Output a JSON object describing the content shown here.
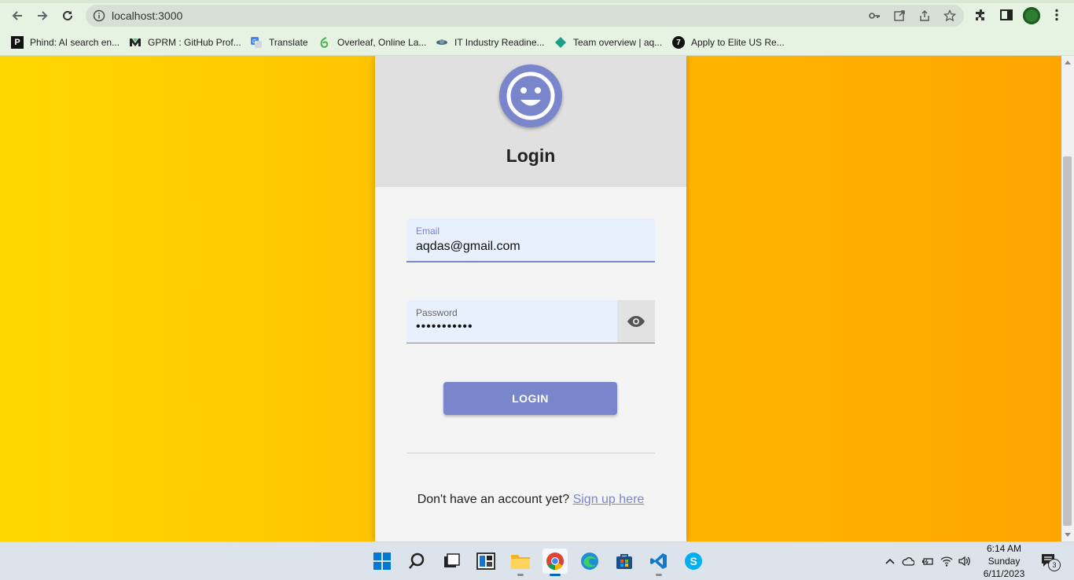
{
  "browser": {
    "url": "localhost:3000",
    "bookmarks": [
      {
        "label": "Phind: AI search en...",
        "icon": "phind-icon"
      },
      {
        "label": "GPRM : GitHub Prof...",
        "icon": "gprm-icon"
      },
      {
        "label": "Translate",
        "icon": "translate-icon"
      },
      {
        "label": "Overleaf, Online La...",
        "icon": "overleaf-icon"
      },
      {
        "label": "IT Industry Readine...",
        "icon": "it-industry-icon"
      },
      {
        "label": "Team overview | aq...",
        "icon": "team-overview-icon"
      },
      {
        "label": "Apply to Elite US Re...",
        "icon": "apply-icon"
      }
    ]
  },
  "login": {
    "title": "Login",
    "email_label": "Email",
    "email_value": "aqdas@gmail.com",
    "password_label": "Password",
    "password_value": "•••••••••••",
    "button_label": "LOGIN",
    "signup_prompt": "Don't have an account yet?",
    "signup_link": "Sign up here"
  },
  "colors": {
    "accent": "#7986cb",
    "background_start": "#ffd700",
    "background_end": "#ffa500",
    "card": "#f4f4f4",
    "header": "#e0e0e0"
  },
  "taskbar": {
    "apps": [
      "windows-start",
      "search",
      "task-view",
      "widgets",
      "file-explorer",
      "chrome",
      "edge",
      "microsoft-store",
      "vscode",
      "skype"
    ],
    "clock": {
      "time": "6:14 AM",
      "day": "Sunday",
      "date": "6/11/2023"
    },
    "notification_count": "3"
  }
}
